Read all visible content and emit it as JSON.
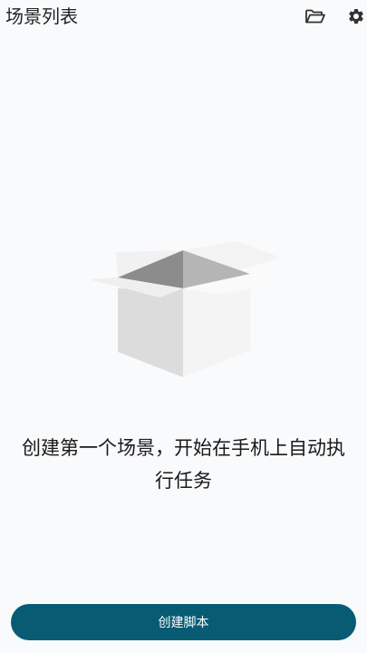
{
  "header": {
    "title": "场景列表",
    "icons": [
      "folder-open-icon",
      "gear-icon"
    ]
  },
  "empty_state": {
    "message_line1": "创建第一个场景，开始在手机上自动执",
    "message_line2": "行任务",
    "illustration": "empty-box-icon"
  },
  "footer": {
    "create_button_label": "创建脚本"
  },
  "colors": {
    "background": "#f9fafc",
    "primary_button": "#075c74",
    "text": "#1a1a1a"
  }
}
